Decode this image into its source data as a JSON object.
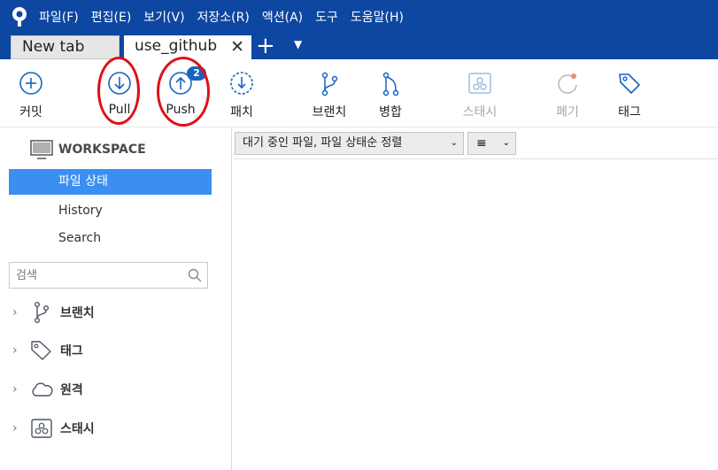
{
  "menubar": {
    "items": [
      "파일(F)",
      "편집(E)",
      "보기(V)",
      "저장소(R)",
      "액션(A)",
      "도구",
      "도움말(H)"
    ]
  },
  "tabs": {
    "new_tab_label": "New tab",
    "active_tab_label": "use_github",
    "close_glyph": "✕",
    "plus_glyph": "+",
    "dropdown_glyph": "▼"
  },
  "toolbar": {
    "commit_label": "커밋",
    "pull_label": "Pull",
    "push_label": "Push",
    "push_badge": "2",
    "patch_label": "패치",
    "branch_label": "브랜치",
    "merge_label": "병합",
    "stash_label": "스태시",
    "discard_label": "폐기",
    "tag_label": "태그"
  },
  "sidebar": {
    "workspace_label": "WORKSPACE",
    "items": [
      "파일 상태",
      "History",
      "Search"
    ],
    "search_placeholder": "검색",
    "groups": [
      "브랜치",
      "태그",
      "원격",
      "스태시"
    ],
    "chevron_glyph": "›"
  },
  "main": {
    "filter_label": "대기 중인 파일, 파일 상태순 정렬",
    "filter_dropdown_glyph": "⌄",
    "view_glyph": "≡",
    "view_dropdown_glyph": "⌄"
  },
  "colors": {
    "menubar_bg": "#0d47a1",
    "accent": "#1565c0",
    "selection": "#3b8ff0",
    "annotation_ring": "#e0101a"
  },
  "icons": {
    "logo": "sourcetree-logo-icon",
    "commit": "plus-circle-icon",
    "pull": "arrow-down-circle-icon",
    "push": "arrow-up-circle-icon",
    "patch": "dashed-arrow-down-circle-icon",
    "branch": "branch-icon",
    "merge": "merge-icon",
    "stash": "stash-icon",
    "discard": "refresh-icon",
    "tag": "tag-icon",
    "workspace": "monitor-icon",
    "search": "magnifier-icon",
    "remote": "cloud-icon"
  }
}
